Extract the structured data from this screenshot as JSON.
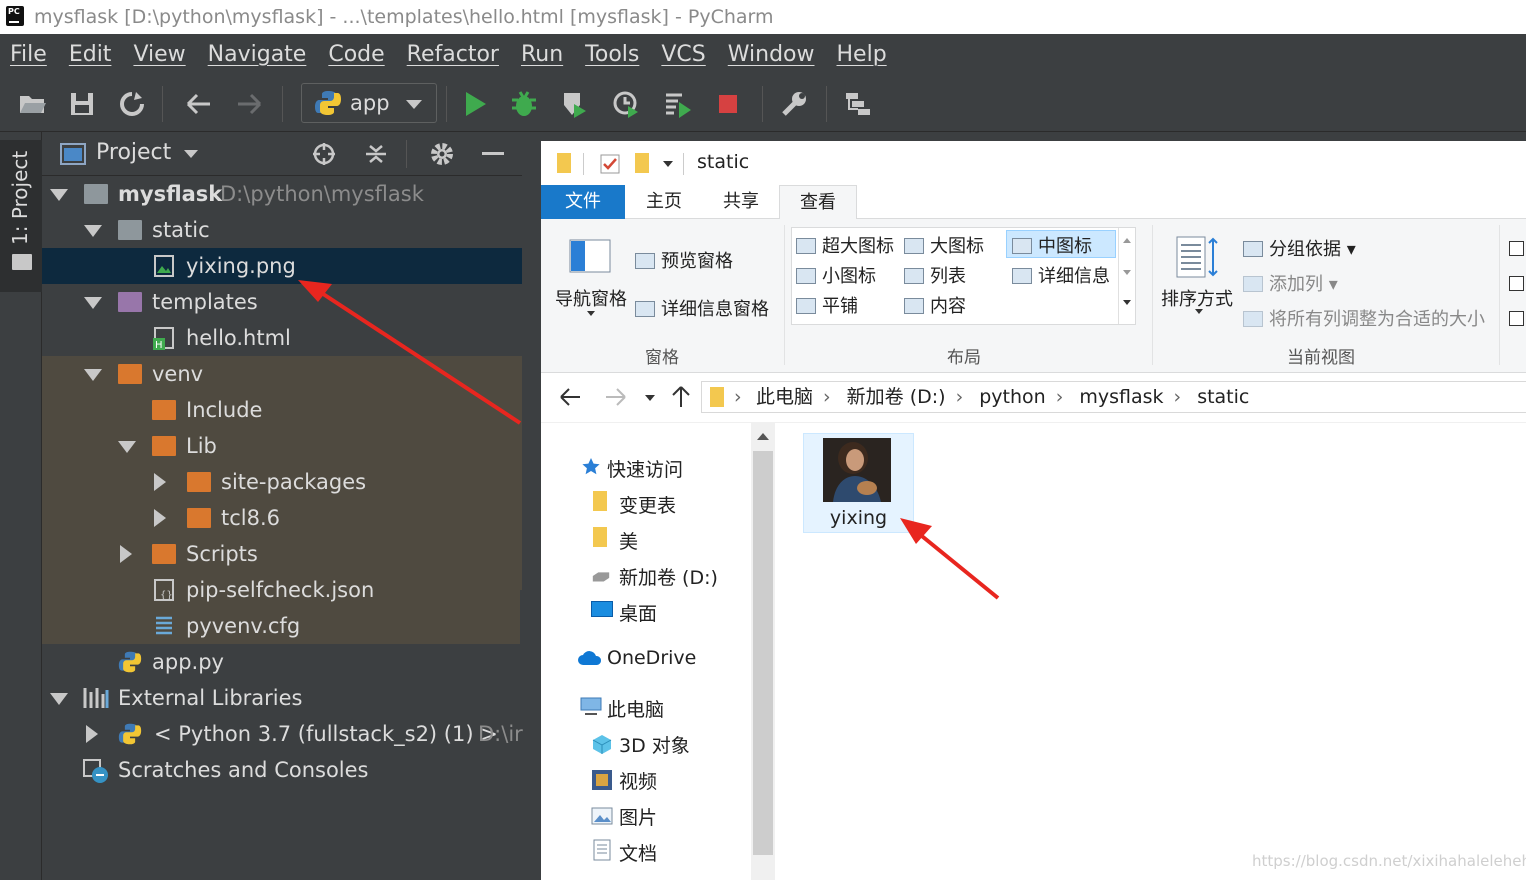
{
  "window": {
    "title": "mysflask [D:\\python\\mysflask] - ...\\templates\\hello.html [mysflask] - PyCharm",
    "logo_text": "PC"
  },
  "menu": [
    "File",
    "Edit",
    "View",
    "Navigate",
    "Code",
    "Refactor",
    "Run",
    "Tools",
    "VCS",
    "Window",
    "Help"
  ],
  "toolbar": {
    "run_config": "app",
    "icons": [
      "open-folder-icon",
      "save-icon",
      "sync-icon",
      "back-arrow-icon",
      "forward-arrow-icon",
      "run-icon",
      "debug-icon",
      "coverage-icon",
      "profile-icon",
      "run-step-icon",
      "stop-icon",
      "settings-wrench-icon",
      "project-structure-icon"
    ]
  },
  "side_tab": {
    "label": "1: Project"
  },
  "project_panel": {
    "title": "Project",
    "tree": [
      {
        "label": "mysflask",
        "path": "D:\\python\\mysflask",
        "bold": true
      },
      {
        "label": "static"
      },
      {
        "label": "yixing.png",
        "selected": true
      },
      {
        "label": "templates"
      },
      {
        "label": "hello.html"
      },
      {
        "label": "venv"
      },
      {
        "label": "Include"
      },
      {
        "label": "Lib"
      },
      {
        "label": "site-packages"
      },
      {
        "label": "tcl8.6"
      },
      {
        "label": "Scripts"
      },
      {
        "label": "pip-selfcheck.json"
      },
      {
        "label": "pyvenv.cfg"
      },
      {
        "label": "app.py"
      },
      {
        "label": "External Libraries"
      },
      {
        "label": "< Python 3.7 (fullstack_s2) (1) >",
        "path": "D:\\ir"
      },
      {
        "label": "Scratches and Consoles"
      }
    ]
  },
  "explorer": {
    "title": "static",
    "tabs": [
      "文件",
      "主页",
      "共享",
      "查看"
    ],
    "active_tab": "查看",
    "ribbon": {
      "pane_group": {
        "nav_pane": "导航窗格",
        "preview_pane": "预览窗格",
        "details_pane": "详细信息窗格",
        "label": "窗格"
      },
      "layout_group": {
        "items": [
          "超大图标",
          "大图标",
          "中图标",
          "小图标",
          "列表",
          "详细信息",
          "平铺",
          "内容"
        ],
        "selected": "中图标",
        "label": "布局"
      },
      "view_group": {
        "sort_by": "排序方式",
        "group_by": "分组依据",
        "add_column": "添加列",
        "fit_columns": "将所有列调整为合适的大小",
        "label": "当前视图"
      }
    },
    "breadcrumb": [
      "此电脑",
      "新加卷 (D:)",
      "python",
      "mysflask",
      "static"
    ],
    "nav": {
      "quick_access": "快速访问",
      "quick_items": [
        "变更表",
        "美",
        "新加卷 (D:)",
        "桌面"
      ],
      "onedrive": "OneDrive",
      "this_pc": "此电脑",
      "pc_items": [
        "3D 对象",
        "视频",
        "图片",
        "文档"
      ]
    },
    "file": {
      "name": "yixing"
    }
  },
  "watermark": "https://blog.csdn.net/xixihahalelehehe",
  "colors": {
    "ide_bg": "#3c3f41",
    "selection": "#0d293e",
    "venv_highlight": "#4f4a40",
    "explorer_accent": "#1979ca",
    "annotation_arrow": "#e8261f"
  }
}
